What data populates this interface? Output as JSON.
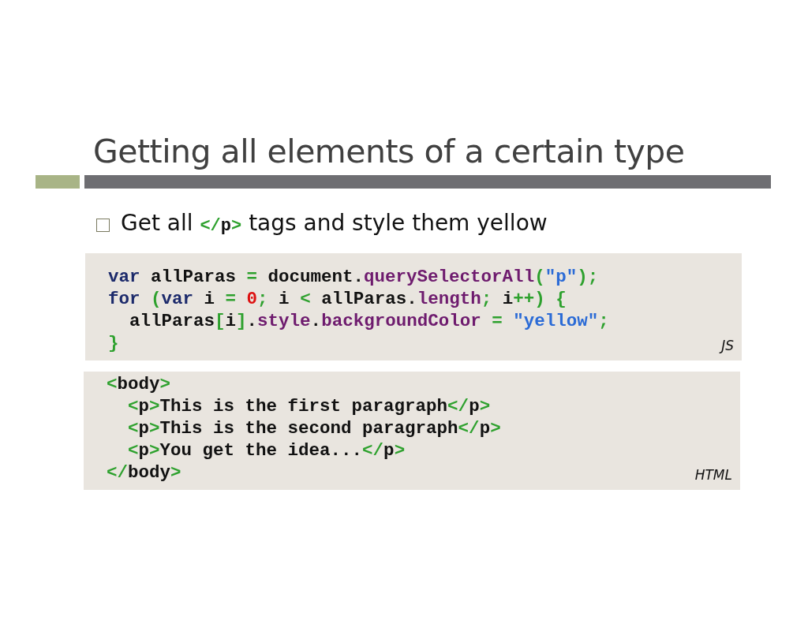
{
  "slide": {
    "title": "Getting all elements of a certain type",
    "bullet": [
      {
        "kind": "text",
        "text": "Get all "
      },
      {
        "kind": "punct",
        "text": "</"
      },
      {
        "kind": "tag",
        "text": "p"
      },
      {
        "kind": "punct",
        "text": ">"
      },
      {
        "kind": "text",
        "text": " tags and style them yellow"
      }
    ],
    "code_blocks": [
      {
        "language": "JS",
        "lines": [
          [
            {
              "kind": "keyword",
              "text": "var"
            },
            {
              "kind": "plain",
              "text": " allParas "
            },
            {
              "kind": "punct",
              "text": "="
            },
            {
              "kind": "plain",
              "text": " document."
            },
            {
              "kind": "method",
              "text": "querySelectorAll"
            },
            {
              "kind": "punct",
              "text": "("
            },
            {
              "kind": "string",
              "text": "\"p\""
            },
            {
              "kind": "punct",
              "text": ");"
            }
          ],
          [
            {
              "kind": "keyword",
              "text": "for"
            },
            {
              "kind": "punct",
              "text": " ("
            },
            {
              "kind": "keyword",
              "text": "var"
            },
            {
              "kind": "plain",
              "text": " i "
            },
            {
              "kind": "punct",
              "text": "= "
            },
            {
              "kind": "number",
              "text": "0"
            },
            {
              "kind": "punct",
              "text": ";"
            },
            {
              "kind": "plain",
              "text": " i "
            },
            {
              "kind": "punct",
              "text": "<"
            },
            {
              "kind": "plain",
              "text": " allParas."
            },
            {
              "kind": "method",
              "text": "length"
            },
            {
              "kind": "punct",
              "text": ";"
            },
            {
              "kind": "plain",
              "text": " i"
            },
            {
              "kind": "punct",
              "text": "++) {"
            }
          ],
          [
            {
              "kind": "plain",
              "text": "  allParas"
            },
            {
              "kind": "punct",
              "text": "["
            },
            {
              "kind": "plain",
              "text": "i"
            },
            {
              "kind": "punct",
              "text": "]"
            },
            {
              "kind": "plain",
              "text": "."
            },
            {
              "kind": "method",
              "text": "style"
            },
            {
              "kind": "plain",
              "text": "."
            },
            {
              "kind": "method",
              "text": "backgroundColor"
            },
            {
              "kind": "punct",
              "text": " = "
            },
            {
              "kind": "string",
              "text": "\"yellow\""
            },
            {
              "kind": "punct",
              "text": ";"
            }
          ],
          [
            {
              "kind": "punct",
              "text": "}"
            }
          ]
        ]
      },
      {
        "language": "HTML",
        "lines": [
          [
            {
              "kind": "punct",
              "text": "<"
            },
            {
              "kind": "plain",
              "text": "body"
            },
            {
              "kind": "punct",
              "text": ">"
            }
          ],
          [
            {
              "kind": "punct",
              "text": "  <"
            },
            {
              "kind": "plain",
              "text": "p"
            },
            {
              "kind": "punct",
              "text": ">"
            },
            {
              "kind": "plain",
              "text": "This is the first paragraph"
            },
            {
              "kind": "punct",
              "text": "</"
            },
            {
              "kind": "plain",
              "text": "p"
            },
            {
              "kind": "punct",
              "text": ">"
            }
          ],
          [
            {
              "kind": "punct",
              "text": "  <"
            },
            {
              "kind": "plain",
              "text": "p"
            },
            {
              "kind": "punct",
              "text": ">"
            },
            {
              "kind": "plain",
              "text": "This is the second paragraph"
            },
            {
              "kind": "punct",
              "text": "</"
            },
            {
              "kind": "plain",
              "text": "p"
            },
            {
              "kind": "punct",
              "text": ">"
            }
          ],
          [
            {
              "kind": "punct",
              "text": "  <"
            },
            {
              "kind": "plain",
              "text": "p"
            },
            {
              "kind": "punct",
              "text": ">"
            },
            {
              "kind": "plain",
              "text": "You get the idea..."
            },
            {
              "kind": "punct",
              "text": "</"
            },
            {
              "kind": "plain",
              "text": "p"
            },
            {
              "kind": "punct",
              "text": ">"
            }
          ],
          [
            {
              "kind": "punct",
              "text": "</"
            },
            {
              "kind": "plain",
              "text": "body"
            },
            {
              "kind": "punct",
              "text": ">"
            }
          ]
        ]
      }
    ]
  }
}
